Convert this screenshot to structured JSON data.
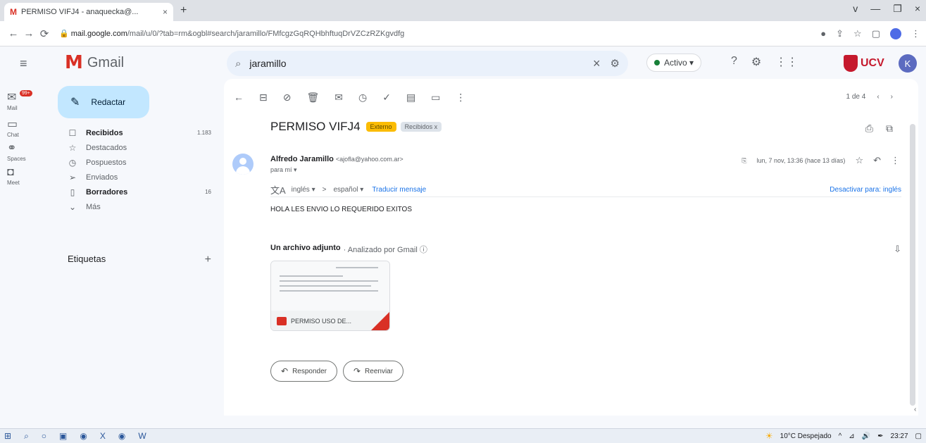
{
  "browser": {
    "tab_title": "PERMISO VIFJ4 - anaquecka@...",
    "tab_favicon": "M",
    "url_host": "mail.google.com",
    "url_path": "/mail/u/0/?tab=rm&ogbl#search/jaramillo/FMfcgzGqRQHbhftuqDrVZCzRZKgvdfg",
    "win_controls": [
      "v",
      "—",
      "❐",
      "×"
    ]
  },
  "gmail": {
    "app_name": "Gmail",
    "search_query": "jaramillo",
    "status": "Activo",
    "avatar_initial": "K",
    "org_logo": "UCV"
  },
  "rail": [
    {
      "label": "Mail",
      "badge": "99+"
    },
    {
      "label": "Chat"
    },
    {
      "label": "Spaces"
    },
    {
      "label": "Meet"
    }
  ],
  "sidebar": {
    "compose": "Redactar",
    "items": [
      {
        "label": "Recibidos",
        "count": "1.183",
        "bold": true,
        "icon": "inbox-icon"
      },
      {
        "label": "Destacados",
        "count": "",
        "bold": false,
        "icon": "star-icon"
      },
      {
        "label": "Pospuestos",
        "count": "",
        "bold": false,
        "icon": "clock-icon"
      },
      {
        "label": "Enviados",
        "count": "",
        "bold": false,
        "icon": "send-icon"
      },
      {
        "label": "Borradores",
        "count": "16",
        "bold": true,
        "icon": "draft-icon"
      },
      {
        "label": "Más",
        "count": "",
        "bold": false,
        "icon": "chevron-down-icon"
      }
    ],
    "labels_title": "Etiquetas"
  },
  "message": {
    "pager": "1 de 4",
    "subject": "PERMISO VIFJ4",
    "badge_external": "Externo",
    "badge_inbox": "Recibidos x",
    "sender_name": "Alfredo Jaramillo",
    "sender_email": "<ajofla@yahoo.com.ar>",
    "to_me": "para mí",
    "date": "lun, 7 nov, 13:36 (hace 13 días)",
    "translate_from": "inglés",
    "translate_to": "español",
    "translate_link": "Traducir mensaje",
    "translate_off": "Desactivar para: inglés",
    "body": "HOLA LES ENVIO LO REQUERIDO EXITOS",
    "attach_title": "Un archivo adjunto",
    "attach_scan": "· Analizado por Gmail ⓘ",
    "attach_name": "PERMISO USO DE...",
    "reply": "Responder",
    "forward": "Reenviar"
  },
  "taskbar": {
    "weather": "10°C Despejado",
    "time": "23:27"
  }
}
